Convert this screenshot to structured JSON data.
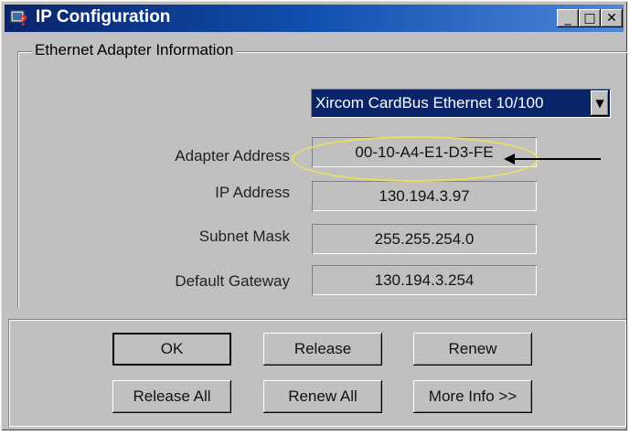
{
  "window": {
    "title": "IP Configuration",
    "controls": {
      "minimize": "_",
      "maximize": "□",
      "close": "✕"
    }
  },
  "group": {
    "label": "Ethernet  Adapter Information"
  },
  "adapter_select": {
    "value": "Xircom CardBus Ethernet 10/100"
  },
  "fields": {
    "adapter_address": {
      "label": "Adapter Address",
      "value": "00-10-A4-E1-D3-FE"
    },
    "ip_address": {
      "label": "IP Address",
      "value": "130.194.3.97"
    },
    "subnet_mask": {
      "label": "Subnet Mask",
      "value": "255.255.254.0"
    },
    "default_gateway": {
      "label": "Default Gateway",
      "value": "130.194.3.254"
    }
  },
  "buttons": {
    "ok": "OK",
    "release": "Release",
    "renew": "Renew",
    "release_all": "Release All",
    "renew_all": "Renew All",
    "more_info": "More Info >>"
  },
  "icons": {
    "title": "ip-config-icon",
    "dropdown": "chevron-down-icon",
    "annotation": "arrow-left-icon"
  },
  "colors": {
    "title_bar": "#0a246a",
    "title_bar_end": "#4f86d8",
    "annotation_ellipse": "#e8e060"
  }
}
